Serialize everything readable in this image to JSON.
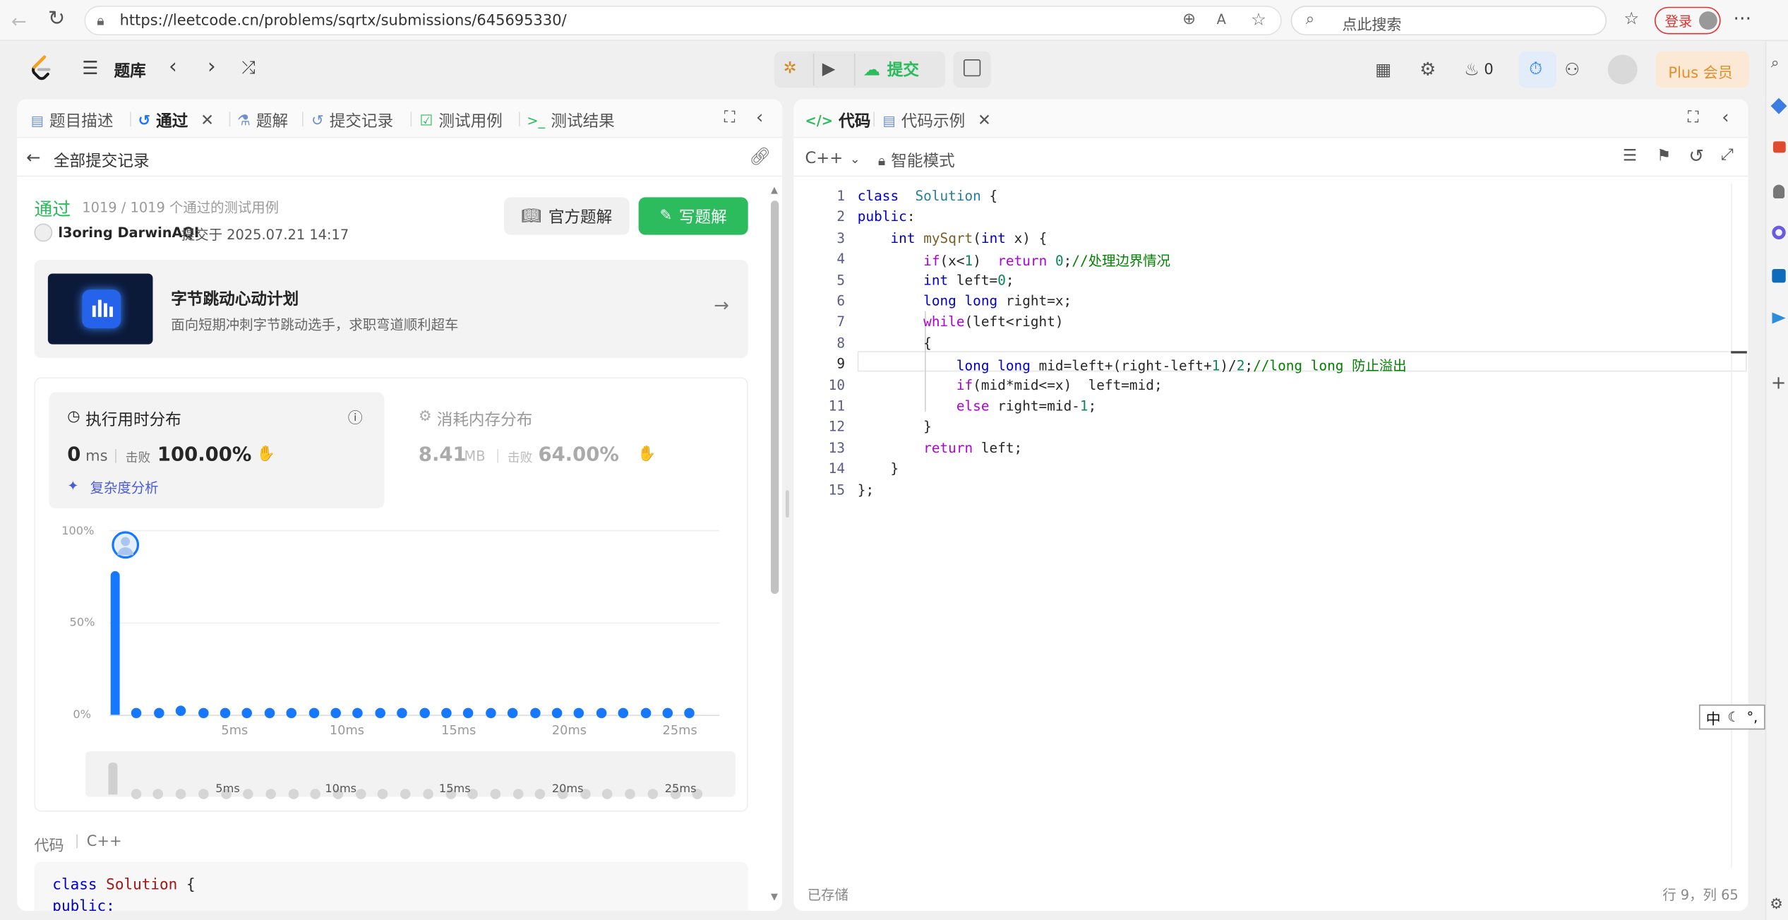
{
  "browser": {
    "url": "https://leetcode.cn/problems/sqrtx/submissions/645695330/",
    "search_placeholder": "点此搜索",
    "login_label": "登录"
  },
  "header": {
    "problem_list": "题库",
    "submit_label": "提交",
    "streak_count": "0",
    "plus_label": "Plus 会员"
  },
  "left_tabs": [
    "题目描述",
    "通过",
    "题解",
    "提交记录",
    "测试用例",
    "测试结果"
  ],
  "subheader": {
    "back_label": "全部提交记录"
  },
  "result": {
    "status": "通过",
    "tests": "1019 / 1019 个通过的测试用例",
    "user": "l3oring DarwinAQI",
    "submitted_at": "提交于 2025.07.21 14:17",
    "official_solution": "官方题解",
    "write_solution": "写题解"
  },
  "banner": {
    "title": "字节跳动心动计划",
    "subtitle": "面向短期冲刺字节跳动选手，求职弯道顺利超车"
  },
  "runtime": {
    "title": "执行用时分布",
    "value": "0",
    "unit": "ms",
    "beat_label": "击败",
    "beat": "100.00%",
    "analysis": "复杂度分析"
  },
  "memory": {
    "title": "消耗内存分布",
    "value": "8.41",
    "unit": "MB",
    "beat_label": "击败",
    "beat": "64.00%"
  },
  "chart_data": {
    "type": "bar",
    "x": [
      0,
      1,
      2,
      3,
      4,
      5,
      6,
      7,
      8,
      9,
      10,
      11,
      12,
      13,
      14,
      15,
      16,
      17,
      18,
      19,
      20,
      21,
      22,
      23,
      24,
      25,
      26
    ],
    "values": [
      78,
      0.5,
      0.5,
      1.5,
      0.5,
      0.5,
      0.5,
      0.5,
      0.5,
      0.5,
      0.5,
      0.5,
      0.5,
      0.5,
      0.5,
      0.5,
      0.5,
      0.5,
      0.5,
      0.5,
      0.5,
      0.5,
      0.5,
      0.5,
      0.5,
      0.5,
      0.5
    ],
    "ytick_labels": [
      "100%",
      "50%",
      "0%"
    ],
    "xtick_labels": [
      "5ms",
      "10ms",
      "15ms",
      "20ms",
      "25ms"
    ],
    "ylim": [
      0,
      100
    ],
    "grid": true
  },
  "code_preview": {
    "label": "代码",
    "lang": "C++",
    "line1_kw": "class",
    "line1_name": "Solution",
    "line1_rest": " {",
    "line2": "public:"
  },
  "right_tabs": [
    "代码",
    "代码示例"
  ],
  "editor": {
    "language": "C++",
    "mode": "智能模式",
    "line_numbers": [
      "1",
      "2",
      "3",
      "4",
      "5",
      "6",
      "7",
      "8",
      "9",
      "10",
      "11",
      "12",
      "13",
      "14",
      "15"
    ],
    "lines": [
      [
        [
          "kw",
          "class"
        ],
        [
          "",
          "  "
        ],
        [
          "ty",
          "Solution"
        ],
        [
          "",
          " {"
        ]
      ],
      [
        [
          "kw",
          "public"
        ],
        [
          "",
          ":"
        ]
      ],
      [
        [
          "",
          "    "
        ],
        [
          "kw",
          "int"
        ],
        [
          "",
          " "
        ],
        [
          "fn",
          "mySqrt"
        ],
        [
          "",
          "("
        ],
        [
          "kw",
          "int"
        ],
        [
          "",
          " x) {"
        ]
      ],
      [
        [
          "",
          "        "
        ],
        [
          "pp",
          "if"
        ],
        [
          "",
          "(x<"
        ],
        [
          "nm",
          "1"
        ],
        [
          "",
          ")  "
        ],
        [
          "pp",
          "return"
        ],
        [
          "",
          " "
        ],
        [
          "nm",
          "0"
        ],
        [
          "",
          ";"
        ],
        [
          "cm",
          "//处理边界情况"
        ]
      ],
      [
        [
          "",
          "        "
        ],
        [
          "kw",
          "int"
        ],
        [
          "",
          " left="
        ],
        [
          "nm",
          "0"
        ],
        [
          "",
          ";"
        ]
      ],
      [
        [
          "",
          "        "
        ],
        [
          "kw",
          "long long"
        ],
        [
          "",
          " right=x;"
        ]
      ],
      [
        [
          "",
          "        "
        ],
        [
          "pp",
          "while"
        ],
        [
          "",
          "(left<right)"
        ]
      ],
      [
        [
          "",
          "        {"
        ]
      ],
      [
        [
          "",
          "            "
        ],
        [
          "kw",
          "long long"
        ],
        [
          "",
          " mid=left+(right-left+"
        ],
        [
          "nm",
          "1"
        ],
        [
          "",
          ")/"
        ],
        [
          "nm",
          "2"
        ],
        [
          "",
          ";"
        ],
        [
          "cm",
          "//long long 防止溢出"
        ]
      ],
      [
        [
          "",
          "            "
        ],
        [
          "pp",
          "if"
        ],
        [
          "",
          "(mid*mid<=x)  left=mid;"
        ]
      ],
      [
        [
          "",
          "            "
        ],
        [
          "pp",
          "else"
        ],
        [
          "",
          " right=mid-"
        ],
        [
          "nm",
          "1"
        ],
        [
          "",
          ";"
        ]
      ],
      [
        [
          "",
          "        }"
        ]
      ],
      [
        [
          "",
          "        "
        ],
        [
          "pp",
          "return"
        ],
        [
          "",
          " left;"
        ]
      ],
      [
        [
          "",
          "    }"
        ]
      ],
      [
        [
          "",
          "};"
        ]
      ]
    ],
    "saved": "已存储",
    "cursor": "行 9，列 65"
  },
  "ime": {
    "label": "中"
  }
}
